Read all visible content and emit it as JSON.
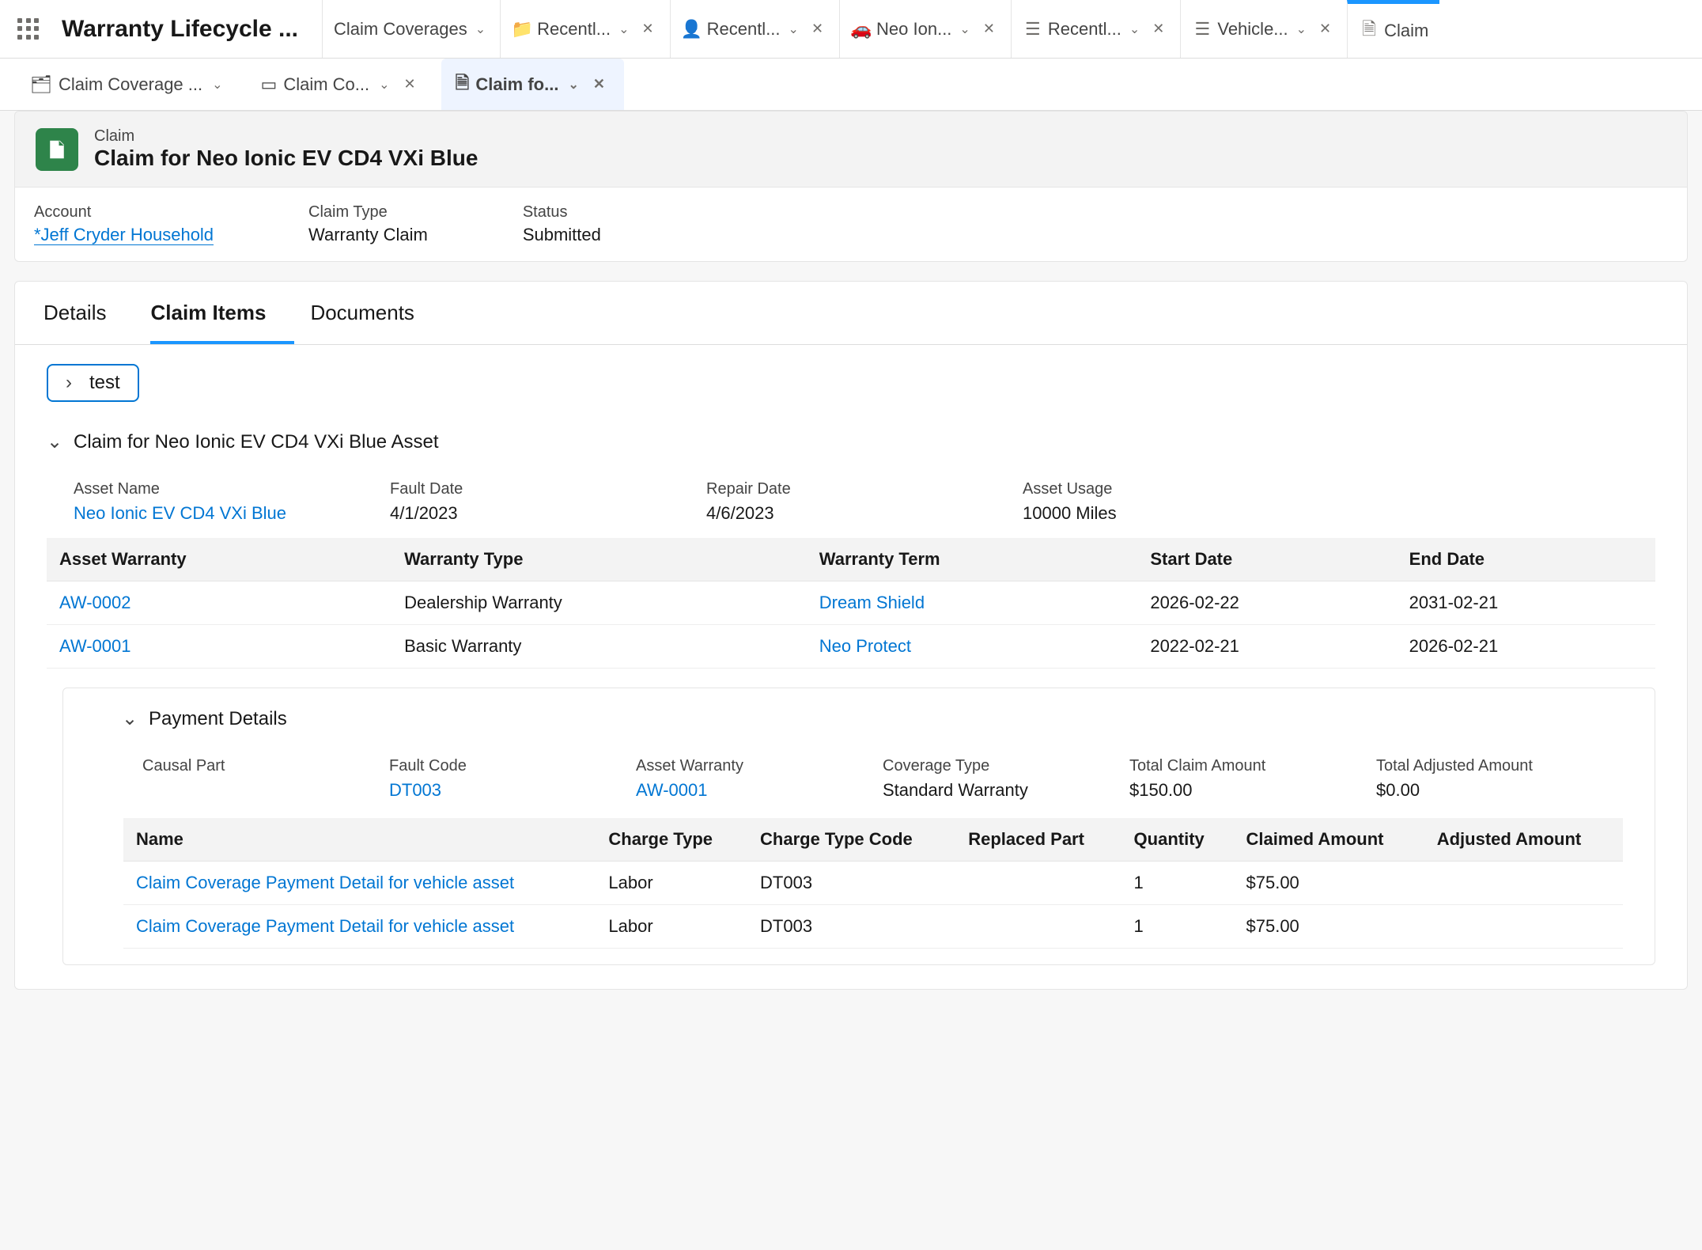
{
  "appTitle": "Warranty Lifecycle ...",
  "primaryTabs": [
    {
      "label": "Claim Coverages",
      "icon": ""
    },
    {
      "label": "Recentl...",
      "icon": "folder"
    },
    {
      "label": "Recentl...",
      "icon": "person"
    },
    {
      "label": "Neo Ion...",
      "icon": "car"
    },
    {
      "label": "Recentl...",
      "icon": "list"
    },
    {
      "label": "Vehicle...",
      "icon": "list"
    },
    {
      "label": "Claim",
      "icon": "doc"
    }
  ],
  "subTabs": [
    {
      "label": "Claim Coverage ...",
      "icon": "folder"
    },
    {
      "label": "Claim Co...",
      "icon": "card"
    },
    {
      "label": "Claim fo...",
      "icon": "doc",
      "active": true
    }
  ],
  "record": {
    "type": "Claim",
    "name": "Claim for Neo Ionic EV CD4 VXi Blue",
    "accountLabel": "Account",
    "accountValue": "*Jeff Cryder Household",
    "claimTypeLabel": "Claim Type",
    "claimTypeValue": "Warranty Claim",
    "statusLabel": "Status",
    "statusValue": "Submitted"
  },
  "detailTabs": [
    "Details",
    "Claim Items",
    "Documents"
  ],
  "testPill": "test",
  "assetSection": {
    "title": "Claim for Neo Ionic EV CD4 VXi Blue Asset",
    "assetNameLabel": "Asset Name",
    "assetNameValue": "Neo Ionic EV CD4 VXi Blue",
    "faultDateLabel": "Fault Date",
    "faultDateValue": "4/1/2023",
    "repairDateLabel": "Repair Date",
    "repairDateValue": "4/6/2023",
    "assetUsageLabel": "Asset Usage",
    "assetUsageValue": "10000 Miles"
  },
  "warrantyTable": {
    "headers": [
      "Asset Warranty",
      "Warranty Type",
      "Warranty Term",
      "Start Date",
      "End Date"
    ],
    "rows": [
      {
        "aw": "AW-0002",
        "type": "Dealership Warranty",
        "term": "Dream Shield",
        "start": "2026-02-22",
        "end": "2031-02-21"
      },
      {
        "aw": "AW-0001",
        "type": "Basic Warranty",
        "term": "Neo Protect",
        "start": "2022-02-21",
        "end": "2026-02-21"
      }
    ]
  },
  "paymentSection": {
    "title": "Payment Details",
    "causalPartLabel": "Causal Part",
    "causalPartValue": "",
    "faultCodeLabel": "Fault Code",
    "faultCodeValue": "DT003",
    "assetWarrantyLabel": "Asset Warranty",
    "assetWarrantyValue": "AW-0001",
    "coverageTypeLabel": "Coverage Type",
    "coverageTypeValue": "Standard Warranty",
    "totalClaimLabel": "Total Claim Amount",
    "totalClaimValue": "$150.00",
    "totalAdjustedLabel": "Total Adjusted Amount",
    "totalAdjustedValue": "$0.00"
  },
  "paymentTable": {
    "headers": [
      "Name",
      "Charge Type",
      "Charge Type Code",
      "Replaced Part",
      "Quantity",
      "Claimed Amount",
      "Adjusted Amount"
    ],
    "rows": [
      {
        "name": "Claim Coverage Payment Detail for vehicle asset",
        "ct": "Labor",
        "ctc": "DT003",
        "rp": "",
        "qty": "1",
        "ca": "$75.00",
        "aa": ""
      },
      {
        "name": "Claim Coverage Payment Detail for vehicle asset",
        "ct": "Labor",
        "ctc": "DT003",
        "rp": "",
        "qty": "1",
        "ca": "$75.00",
        "aa": ""
      }
    ]
  }
}
